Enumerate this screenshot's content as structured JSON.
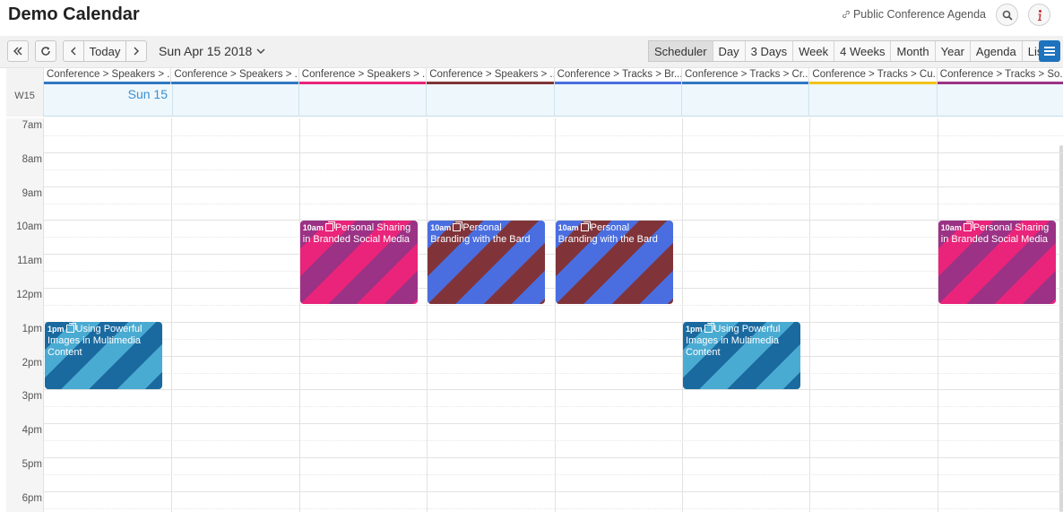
{
  "app": {
    "title": "Demo Calendar",
    "public_link": "Public Conference Agenda"
  },
  "toolbar": {
    "today_label": "Today",
    "date_label": "Sun Apr 15 2018",
    "views": [
      "Scheduler",
      "Day",
      "3 Days",
      "Week",
      "4 Weeks",
      "Month",
      "Year",
      "Agenda",
      "List"
    ],
    "active_view": "Scheduler"
  },
  "columns": [
    {
      "label": "Conference > Speakers > ...",
      "color": "#2f78c2"
    },
    {
      "label": "Conference > Speakers > ...",
      "color": "#2f78c2"
    },
    {
      "label": "Conference > Speakers > ...",
      "color": "#e9247a"
    },
    {
      "label": "Conference > Speakers > ...",
      "color": "#80343a"
    },
    {
      "label": "Conference > Tracks > Br...",
      "color": "#4a6ee0"
    },
    {
      "label": "Conference > Tracks > Cr...",
      "color": "#2f78c2"
    },
    {
      "label": "Conference > Tracks > Cu...",
      "color": "#f2c21b"
    },
    {
      "label": "Conference > Tracks > So...",
      "color": "#9b3285"
    }
  ],
  "allday": {
    "week_label": "W15",
    "day_label": "Sun 15"
  },
  "hours": [
    "7am",
    "8am",
    "9am",
    "10am",
    "11am",
    "12pm",
    "1pm",
    "2pm",
    "3pm",
    "4pm",
    "5pm",
    "6pm"
  ],
  "events": [
    {
      "time": "10am",
      "title": "Personal Sharing in Branded Social Media",
      "column": 2,
      "style": "pink"
    },
    {
      "time": "10am",
      "title": "Personal Branding with the Bard",
      "column": 3,
      "style": "bluebrown"
    },
    {
      "time": "10am",
      "title": "Personal Branding with the Bard",
      "column": 4,
      "style": "bluebrown"
    },
    {
      "time": "10am",
      "title": "Personal Sharing in Branded Social Media",
      "column": 7,
      "style": "pink"
    },
    {
      "time": "1pm",
      "title": "Using Powerful Images in Multimedia Content",
      "column": 0,
      "style": "teal"
    },
    {
      "time": "1pm",
      "title": "Using Powerful Images in Multimedia Content",
      "column": 5,
      "style": "teal"
    }
  ]
}
